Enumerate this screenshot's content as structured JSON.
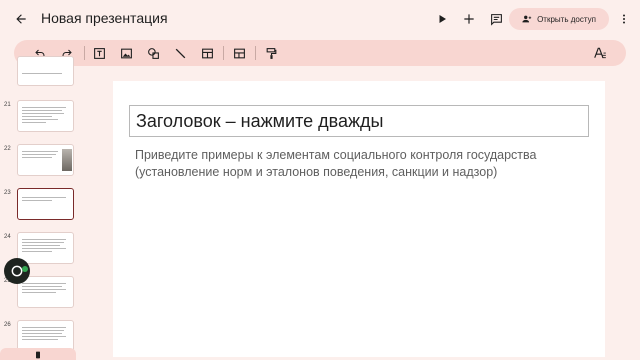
{
  "header": {
    "title": "Новая презентация",
    "share_label": "Открыть доступ"
  },
  "icons": {
    "back": "arrow-back-icon",
    "play": "play-icon",
    "add": "add-icon",
    "comments": "comments-icon",
    "share": "person-add-icon",
    "more": "more-vert-icon"
  },
  "toolbar": {
    "items": [
      "undo-icon",
      "redo-icon",
      "text-box-icon",
      "image-icon",
      "shapes-icon",
      "line-icon",
      "table-icon",
      "layout-icon",
      "paint-format-icon",
      "text-format-icon"
    ]
  },
  "filmstrip": {
    "slides": [
      {
        "number": ""
      },
      {
        "number": "21"
      },
      {
        "number": "22"
      },
      {
        "number": "23"
      },
      {
        "number": "24"
      },
      {
        "number": "25"
      },
      {
        "number": "26"
      }
    ]
  },
  "slide": {
    "title_placeholder": "Заголовок – нажмите дважды",
    "body_line1": "Приведите примеры к элементам социального контроля государства",
    "body_line2": "(установление норм и эталонов поведения, санкции и надзор)"
  },
  "colors": {
    "background": "#fcefec",
    "toolbar": "#f8d6d1",
    "accent": "#7a2a2a",
    "floating_status": "#34a853"
  }
}
